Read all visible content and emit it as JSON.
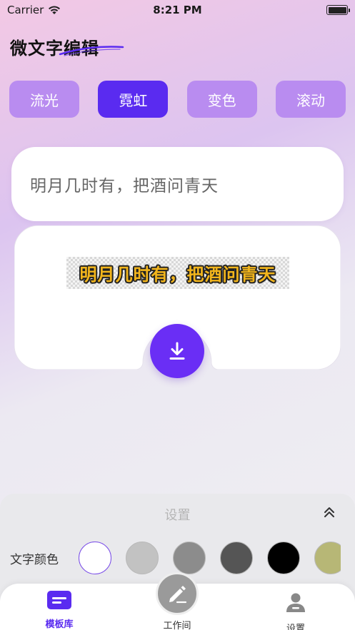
{
  "status_bar": {
    "carrier": "Carrier",
    "time": "8:21 PM"
  },
  "app": {
    "title": "微文字编辑",
    "accent_color": "#5a2bf0"
  },
  "effect_tabs": [
    {
      "label": "流光",
      "active": false
    },
    {
      "label": "霓虹",
      "active": true
    },
    {
      "label": "变色",
      "active": false
    },
    {
      "label": "滚动",
      "active": false
    }
  ],
  "input": {
    "value": "明月几时有，把酒问青天"
  },
  "preview": {
    "text": "明月几时有，把酒问青天",
    "text_color": "#f2b51c",
    "outline_color": "#222222"
  },
  "settings": {
    "title": "设置",
    "text_color_label": "文字颜色",
    "swatches": [
      "#ffffff",
      "#c2c2c2",
      "#8c8c8c",
      "#555555",
      "#000000",
      "#b7b776"
    ],
    "selected_swatch": 0
  },
  "tabbar": {
    "templates_label": "模板库",
    "workshop_label": "工作间",
    "settings_label": "设置"
  },
  "icons": {
    "wifi": "wifi-icon",
    "battery": "battery-icon",
    "download": "download-icon",
    "collapse": "chevron-double-up-icon",
    "templates": "template-icon",
    "workshop": "edit-pencil-icon",
    "settings": "user-settings-icon"
  }
}
